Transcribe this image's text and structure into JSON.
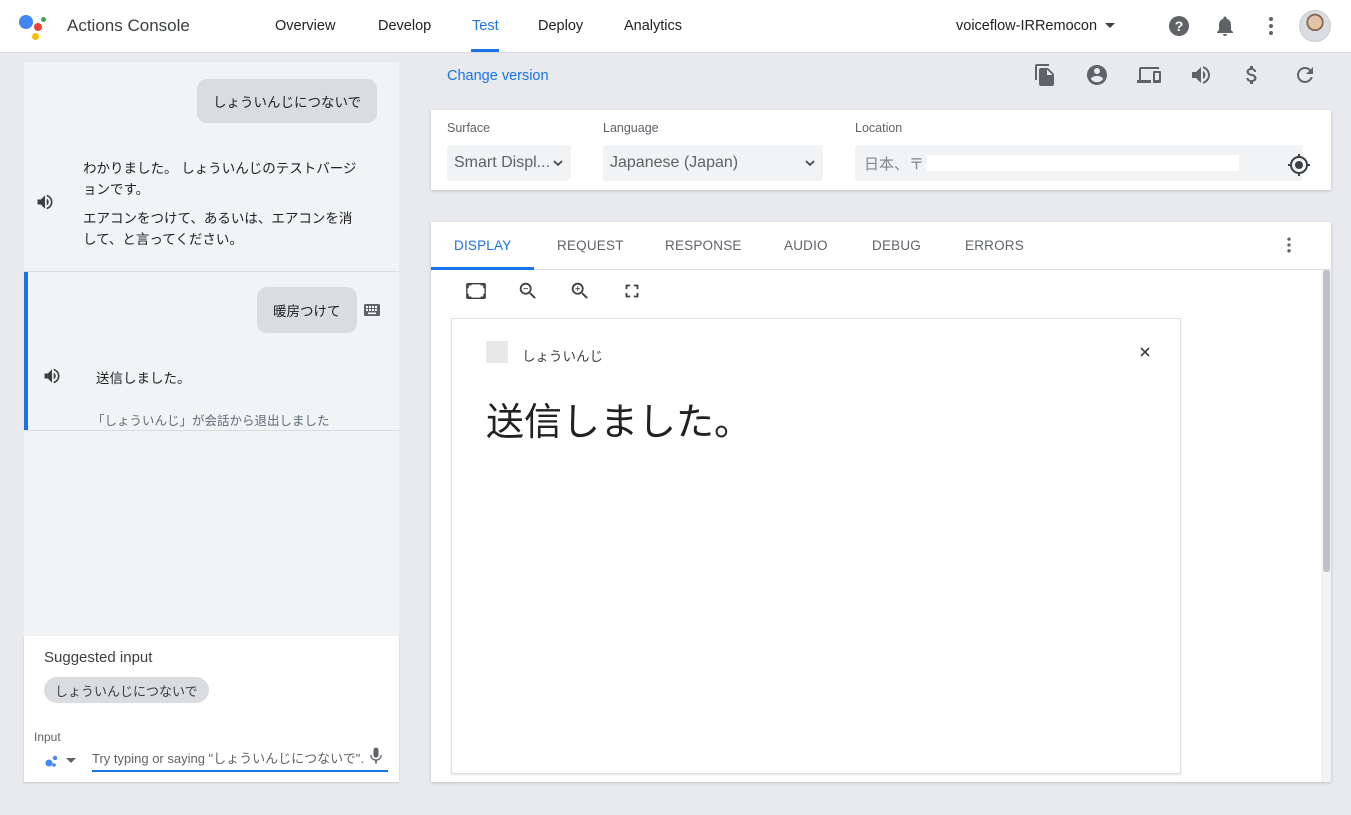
{
  "topbar": {
    "app_title": "Actions Console",
    "nav": [
      "Overview",
      "Develop",
      "Test",
      "Deploy",
      "Analytics"
    ],
    "active_nav": "Test",
    "project_name": "voiceflow-IRRemocon",
    "icons": [
      "help-icon",
      "notifications-icon",
      "more-vert-icon",
      "avatar"
    ]
  },
  "conversation": {
    "turns": [
      {
        "user": "しょういんじにつないで",
        "bot_line1": "わかりました。 しょういんじのテストバージ",
        "bot_line2": "ョンです。",
        "bot_line3": "エアコンをつけて、あるいは、エアコンを消",
        "bot_line4": "して、と言ってください。"
      },
      {
        "user": "暖房つけて",
        "bot_line1": "送信しました。",
        "exit_note": "「しょういんじ」が会話から退出しました"
      }
    ],
    "suggested_title": "Suggested input",
    "suggestion_chip": "しょういんじにつないで",
    "input_label": "Input",
    "input_placeholder": "Try typing or saying \"しょういんじにつないで\".",
    "input_value": ""
  },
  "simulator": {
    "change_version": "Change version",
    "toolbar_icons": [
      "copy-icon",
      "account-icon",
      "devices-icon",
      "volume-icon",
      "dollar-icon",
      "refresh-icon"
    ],
    "surface_label": "Surface",
    "surface_value": "Smart Displ...",
    "language_label": "Language",
    "language_value": "Japanese (Japan)",
    "location_label": "Location",
    "location_value": "日本、〒"
  },
  "display_panel": {
    "tabs": [
      "DISPLAY",
      "REQUEST",
      "RESPONSE",
      "AUDIO",
      "DEBUG",
      "ERRORS"
    ],
    "active_tab": "DISPLAY",
    "app_name": "しょういんじ",
    "message": "送信しました。"
  },
  "colors": {
    "accent": "#1a73e8",
    "background": "#e8eaed",
    "chip": "#dadce0"
  }
}
